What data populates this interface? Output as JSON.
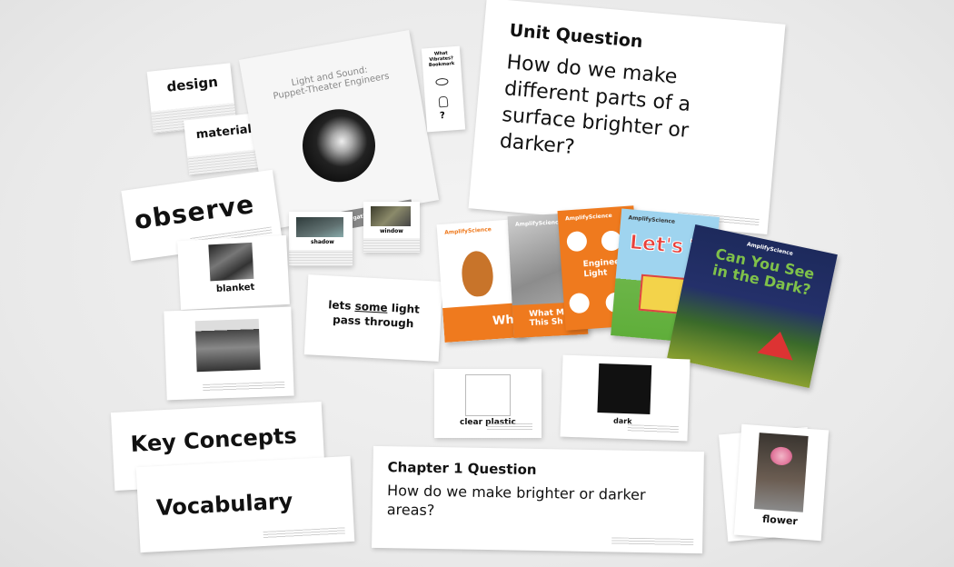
{
  "cards": {
    "design": "design",
    "material": "material",
    "observe": "observe",
    "blanket": "blanket",
    "shadow": "shadow",
    "window": "window",
    "lets_prefix": "lets ",
    "lets_some": "some",
    "lets_suffix": " light",
    "pass_through": "pass through",
    "clear_plastic": "clear plastic",
    "dark": "dark",
    "key_concepts": "Key Concepts",
    "vocabulary": "Vocabulary",
    "flower": "flower"
  },
  "notebook": {
    "title": "Light and Sound:",
    "subtitle": "Puppet-Theater Engineers",
    "label": "Investigation Notebook"
  },
  "bookmark": {
    "title": "What Vibrates? Bookmark"
  },
  "unit_question": {
    "heading": "Unit Question",
    "text": "How do we make different parts of a surface brighter or darker?"
  },
  "chapter_question": {
    "heading": "Chapter 1 Question",
    "text": "How do we make brighter or darker areas?"
  },
  "books": [
    {
      "brand": "AmplifyScience",
      "title": "What"
    },
    {
      "brand": "AmplifyScience",
      "title": "What M This Sh"
    },
    {
      "brand": "AmplifyScience",
      "title": "Engineer Light"
    },
    {
      "brand": "AmplifyScience",
      "title": "Let's Tes"
    },
    {
      "brand": "AmplifyScience",
      "title": "Can You See in the Dark?"
    }
  ],
  "colors": {
    "orange": "#ef7a1e",
    "gray_cover": "#9a9a9a",
    "green_cover": "#5fae3a",
    "navy_cover": "#1d2a5c"
  }
}
